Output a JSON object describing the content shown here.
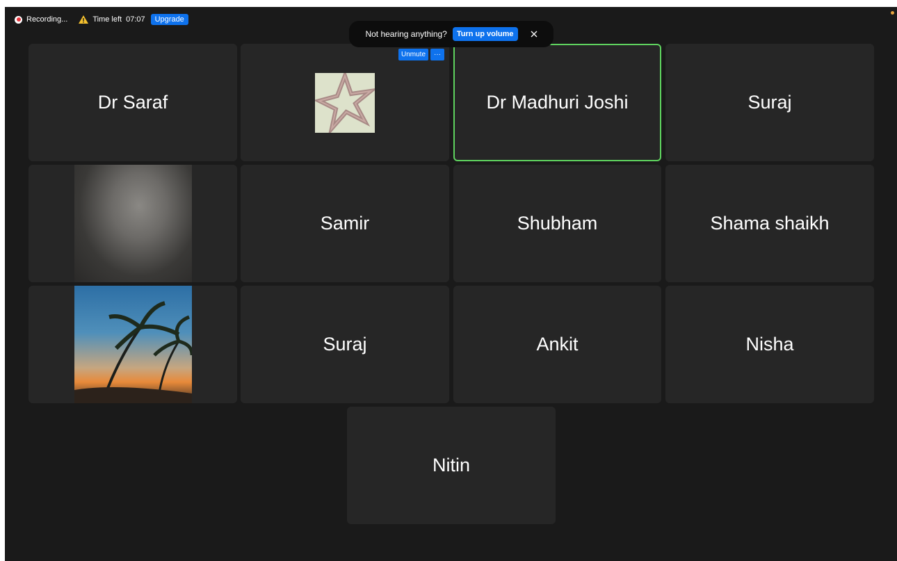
{
  "status_bar": {
    "recording_label": "Recording...",
    "time_left_label": "Time left",
    "time_left_value": "07:07",
    "upgrade_label": "Upgrade"
  },
  "toast": {
    "message": "Not hearing anything?",
    "action_label": "Turn up volume"
  },
  "tile_controls": {
    "unmute_label": "Unmute",
    "more_label": "···"
  },
  "participants": [
    {
      "name": "Dr Saraf"
    },
    {
      "name": ""
    },
    {
      "name": "Dr Madhuri Joshi",
      "active_speaker": true
    },
    {
      "name": "Suraj"
    },
    {
      "name": ""
    },
    {
      "name": "Samir"
    },
    {
      "name": "Shubham"
    },
    {
      "name": "Shama shaikh"
    },
    {
      "name": ""
    },
    {
      "name": "Suraj"
    },
    {
      "name": "Ankit"
    },
    {
      "name": "Nisha"
    },
    {
      "name": "Nitin"
    }
  ],
  "colors": {
    "accent": "#0e72ed",
    "active_border": "#5fd35f",
    "recording": "#e8363d",
    "warning": "#f5c12e"
  }
}
